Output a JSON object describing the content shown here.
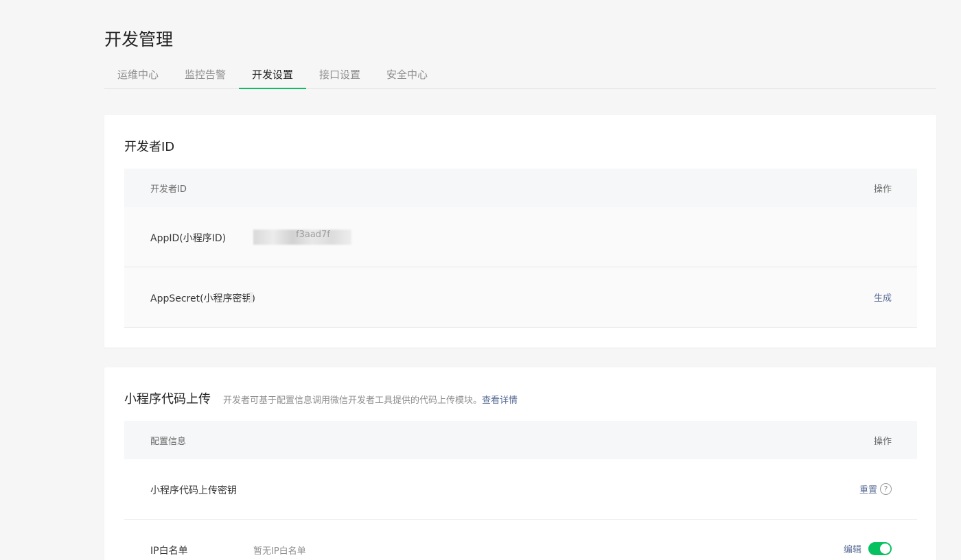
{
  "page": {
    "title": "开发管理"
  },
  "tabs": [
    {
      "label": "运维中心",
      "active": false
    },
    {
      "label": "监控告警",
      "active": false
    },
    {
      "label": "开发设置",
      "active": true
    },
    {
      "label": "接口设置",
      "active": false
    },
    {
      "label": "安全中心",
      "active": false
    }
  ],
  "dev_id": {
    "title": "开发者ID",
    "header": {
      "left": "开发者ID",
      "right": "操作"
    },
    "rows": [
      {
        "label": "AppID(小程序ID)",
        "value": "f3aad7f"
      },
      {
        "label": "AppSecret(小程序密钥)",
        "action": "生成"
      }
    ]
  },
  "upload": {
    "title": "小程序代码上传",
    "desc": "开发者可基于配置信息调用微信开发者工具提供的代码上传模块。",
    "desc_link": "查看详情",
    "header": {
      "left": "配置信息",
      "right": "操作"
    },
    "rows": [
      {
        "label": "小程序代码上传密钥",
        "action": "重置",
        "help_icon": "?"
      },
      {
        "label": "IP白名单",
        "value": "暂无IP白名单",
        "action": "编辑",
        "toggle_on": true
      }
    ]
  },
  "colors": {
    "accent": "#07c160",
    "link": "#576b95"
  }
}
